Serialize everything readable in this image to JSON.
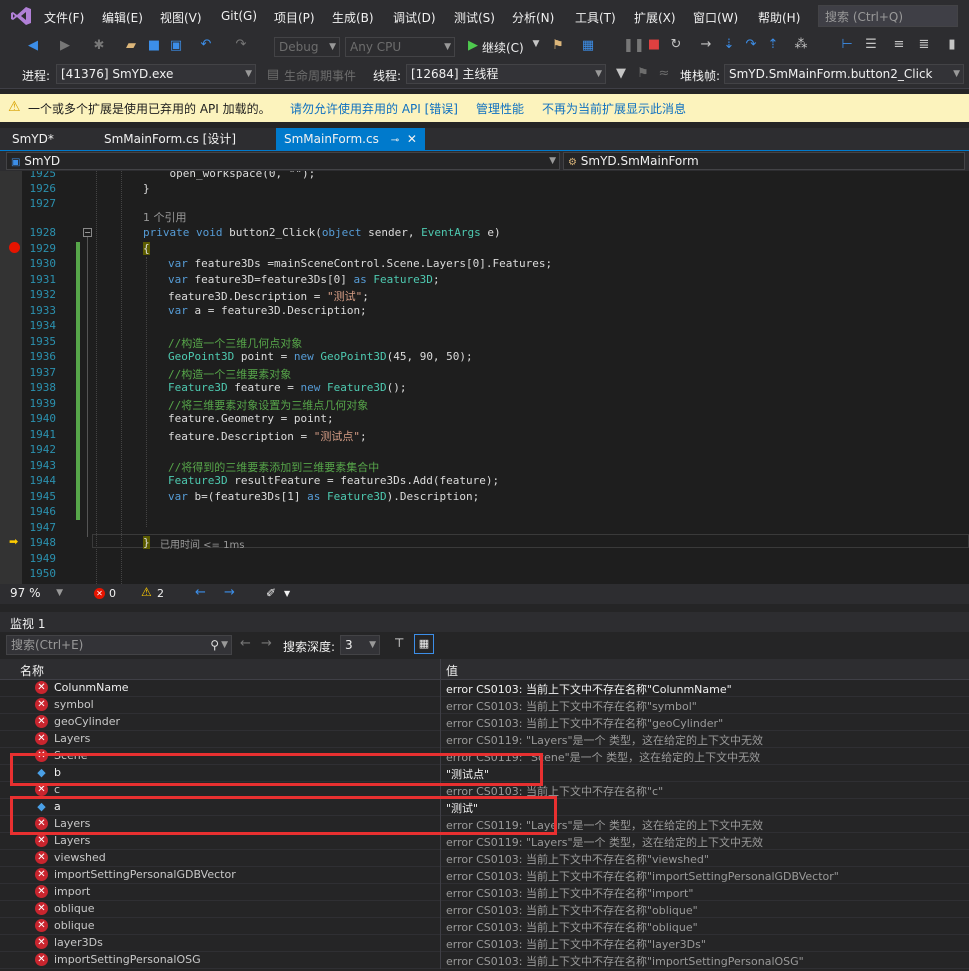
{
  "menu": {
    "items": [
      "文件(F)",
      "编辑(E)",
      "视图(V)",
      "Git(G)",
      "项目(P)",
      "生成(B)",
      "调试(D)",
      "测试(S)",
      "分析(N)",
      "工具(T)",
      "扩展(X)",
      "窗口(W)",
      "帮助(H)"
    ],
    "search_placeholder": "搜索 (Ctrl+Q)"
  },
  "toolbar": {
    "config": "Debug",
    "platform": "Any CPU",
    "continue_label": "继续(C)",
    "process_label": "进程:",
    "process_value": "[41376] SmYD.exe",
    "lifecycle_label": "生命周期事件",
    "thread_label": "线程:",
    "thread_value": "[12684] 主线程",
    "stack_label": "堆栈帧:",
    "stack_value": "SmYD.SmMainForm.button2_Click"
  },
  "infobar": {
    "message": "一个或多个扩展是使用已弃用的 API 加载的。",
    "link1": "请勿允许使用弃用的 API [错误]",
    "link2": "管理性能",
    "link3": "不再为当前扩展显示此消息"
  },
  "tabs": [
    {
      "label": "SmYD*",
      "active": false
    },
    {
      "label": "SmMainForm.cs [设计]",
      "active": false
    },
    {
      "label": "SmMainForm.cs",
      "active": true
    }
  ],
  "navbar": {
    "project": "SmYD",
    "type": "SmYD.SmMainForm"
  },
  "editor": {
    "line_numbers": [
      "1925",
      "1926",
      "1927",
      "1928",
      "1929",
      "1930",
      "1931",
      "1932",
      "1933",
      "1934",
      "1935",
      "1936",
      "1937",
      "1938",
      "1939",
      "1940",
      "1941",
      "1942",
      "1943",
      "1944",
      "1945",
      "1946",
      "1947",
      "1948",
      "1949",
      "1950"
    ],
    "references": "1 个引用",
    "elapsed": "已用时间 <= 1ms",
    "lines": {
      "l1925": "    open_workspace(0, \"\");",
      "l1926": "}",
      "l1928a": "private void ",
      "l1928b": "button2_Click",
      "l1928c": "(",
      "l1928d": "object",
      "l1928e": " sender, ",
      "l1928f": "EventArgs",
      "l1928g": " e)",
      "l1929": "{",
      "l1930a": "var",
      "l1930b": " feature3Ds =mainSceneControl.Scene.Layers[0].Features;",
      "l1931a": "var",
      "l1931b": " feature3D=feature3Ds[0] ",
      "l1931c": "as",
      "l1931d": " ",
      "l1931e": "Feature3D",
      "l1931f": ";",
      "l1932a": "feature3D.Description = ",
      "l1932b": "\"测试\"",
      "l1932c": ";",
      "l1933a": "var",
      "l1933b": " a = feature3D.Description;",
      "l1935": "//构造一个三维几何点对象",
      "l1936a": "GeoPoint3D",
      "l1936b": " point = ",
      "l1936c": "new",
      "l1936d": " ",
      "l1936e": "GeoPoint3D",
      "l1936f": "(45, 90, 50);",
      "l1937": "//构造一个三维要素对象",
      "l1938a": "Feature3D",
      "l1938b": " feature = ",
      "l1938c": "new",
      "l1938d": " ",
      "l1938e": "Feature3D",
      "l1938f": "();",
      "l1939": "//将三维要素对象设置为三维点几何对象",
      "l1940": "feature.Geometry = point;",
      "l1941a": "feature.Description = ",
      "l1941b": "\"测试点\"",
      "l1941c": ";",
      "l1943": "//将得到的三维要素添加到三维要素集合中",
      "l1944a": "Feature3D",
      "l1944b": " resultFeature = feature3Ds.Add(feature);",
      "l1945a": "var",
      "l1945b": " b=(feature3Ds[1] ",
      "l1945c": "as",
      "l1945d": " ",
      "l1945e": "Feature3D",
      "l1945f": ").Description;",
      "l1948": "}"
    }
  },
  "editor_status": {
    "zoom": "97 %",
    "errors": "0",
    "warnings": "2"
  },
  "watch": {
    "title": "监视 1",
    "search_placeholder": "搜索(Ctrl+E)",
    "depth_label": "搜索深度:",
    "depth_value": "3",
    "col_name": "名称",
    "col_value": "值",
    "rows": [
      {
        "name": "ColunmName",
        "value": "error CS0103: 当前上下文中不存在名称\"ColunmName\"",
        "kind": "error",
        "strong": true
      },
      {
        "name": "symbol",
        "value": "error CS0103: 当前上下文中不存在名称\"symbol\"",
        "kind": "error",
        "strong": false
      },
      {
        "name": "geoCylinder",
        "value": "error CS0103: 当前上下文中不存在名称\"geoCylinder\"",
        "kind": "error",
        "strong": false
      },
      {
        "name": "Layers",
        "value": "error CS0119: \"Layers\"是一个 类型，这在给定的上下文中无效",
        "kind": "error",
        "strong": false
      },
      {
        "name": "Scene",
        "value": "error CS0119: \"Scene\"是一个 类型，这在给定的上下文中无效",
        "kind": "error",
        "strong": false
      },
      {
        "name": "b",
        "value": "\"测试点\"",
        "kind": "object",
        "strong": true
      },
      {
        "name": "c",
        "value": "error CS0103: 当前上下文中不存在名称\"c\"",
        "kind": "error",
        "strong": false
      },
      {
        "name": "a",
        "value": "\"测试\"",
        "kind": "object",
        "strong": true
      },
      {
        "name": "Layers",
        "value": "error CS0119: \"Layers\"是一个 类型，这在给定的上下文中无效",
        "kind": "error",
        "strong": false
      },
      {
        "name": "Layers",
        "value": "error CS0119: \"Layers\"是一个 类型，这在给定的上下文中无效",
        "kind": "error",
        "strong": false
      },
      {
        "name": "viewshed",
        "value": "error CS0103: 当前上下文中不存在名称\"viewshed\"",
        "kind": "error",
        "strong": false
      },
      {
        "name": "importSettingPersonalGDBVector",
        "value": "error CS0103: 当前上下文中不存在名称\"importSettingPersonalGDBVector\"",
        "kind": "error",
        "strong": false
      },
      {
        "name": "import",
        "value": "error CS0103: 当前上下文中不存在名称\"import\"",
        "kind": "error",
        "strong": false
      },
      {
        "name": "oblique",
        "value": "error CS0103: 当前上下文中不存在名称\"oblique\"",
        "kind": "error",
        "strong": false
      },
      {
        "name": "oblique",
        "value": "error CS0103: 当前上下文中不存在名称\"oblique\"",
        "kind": "error",
        "strong": false
      },
      {
        "name": "layer3Ds",
        "value": "error CS0103: 当前上下文中不存在名称\"layer3Ds\"",
        "kind": "error",
        "strong": false
      },
      {
        "name": "importSettingPersonalOSG",
        "value": "error CS0103: 当前上下文中不存在名称\"importSettingPersonalOSG\"",
        "kind": "error",
        "strong": false
      }
    ]
  },
  "colors": {
    "accent": "#007acc",
    "highlight_box": "#e83030",
    "error_icon": "#c9252e"
  }
}
